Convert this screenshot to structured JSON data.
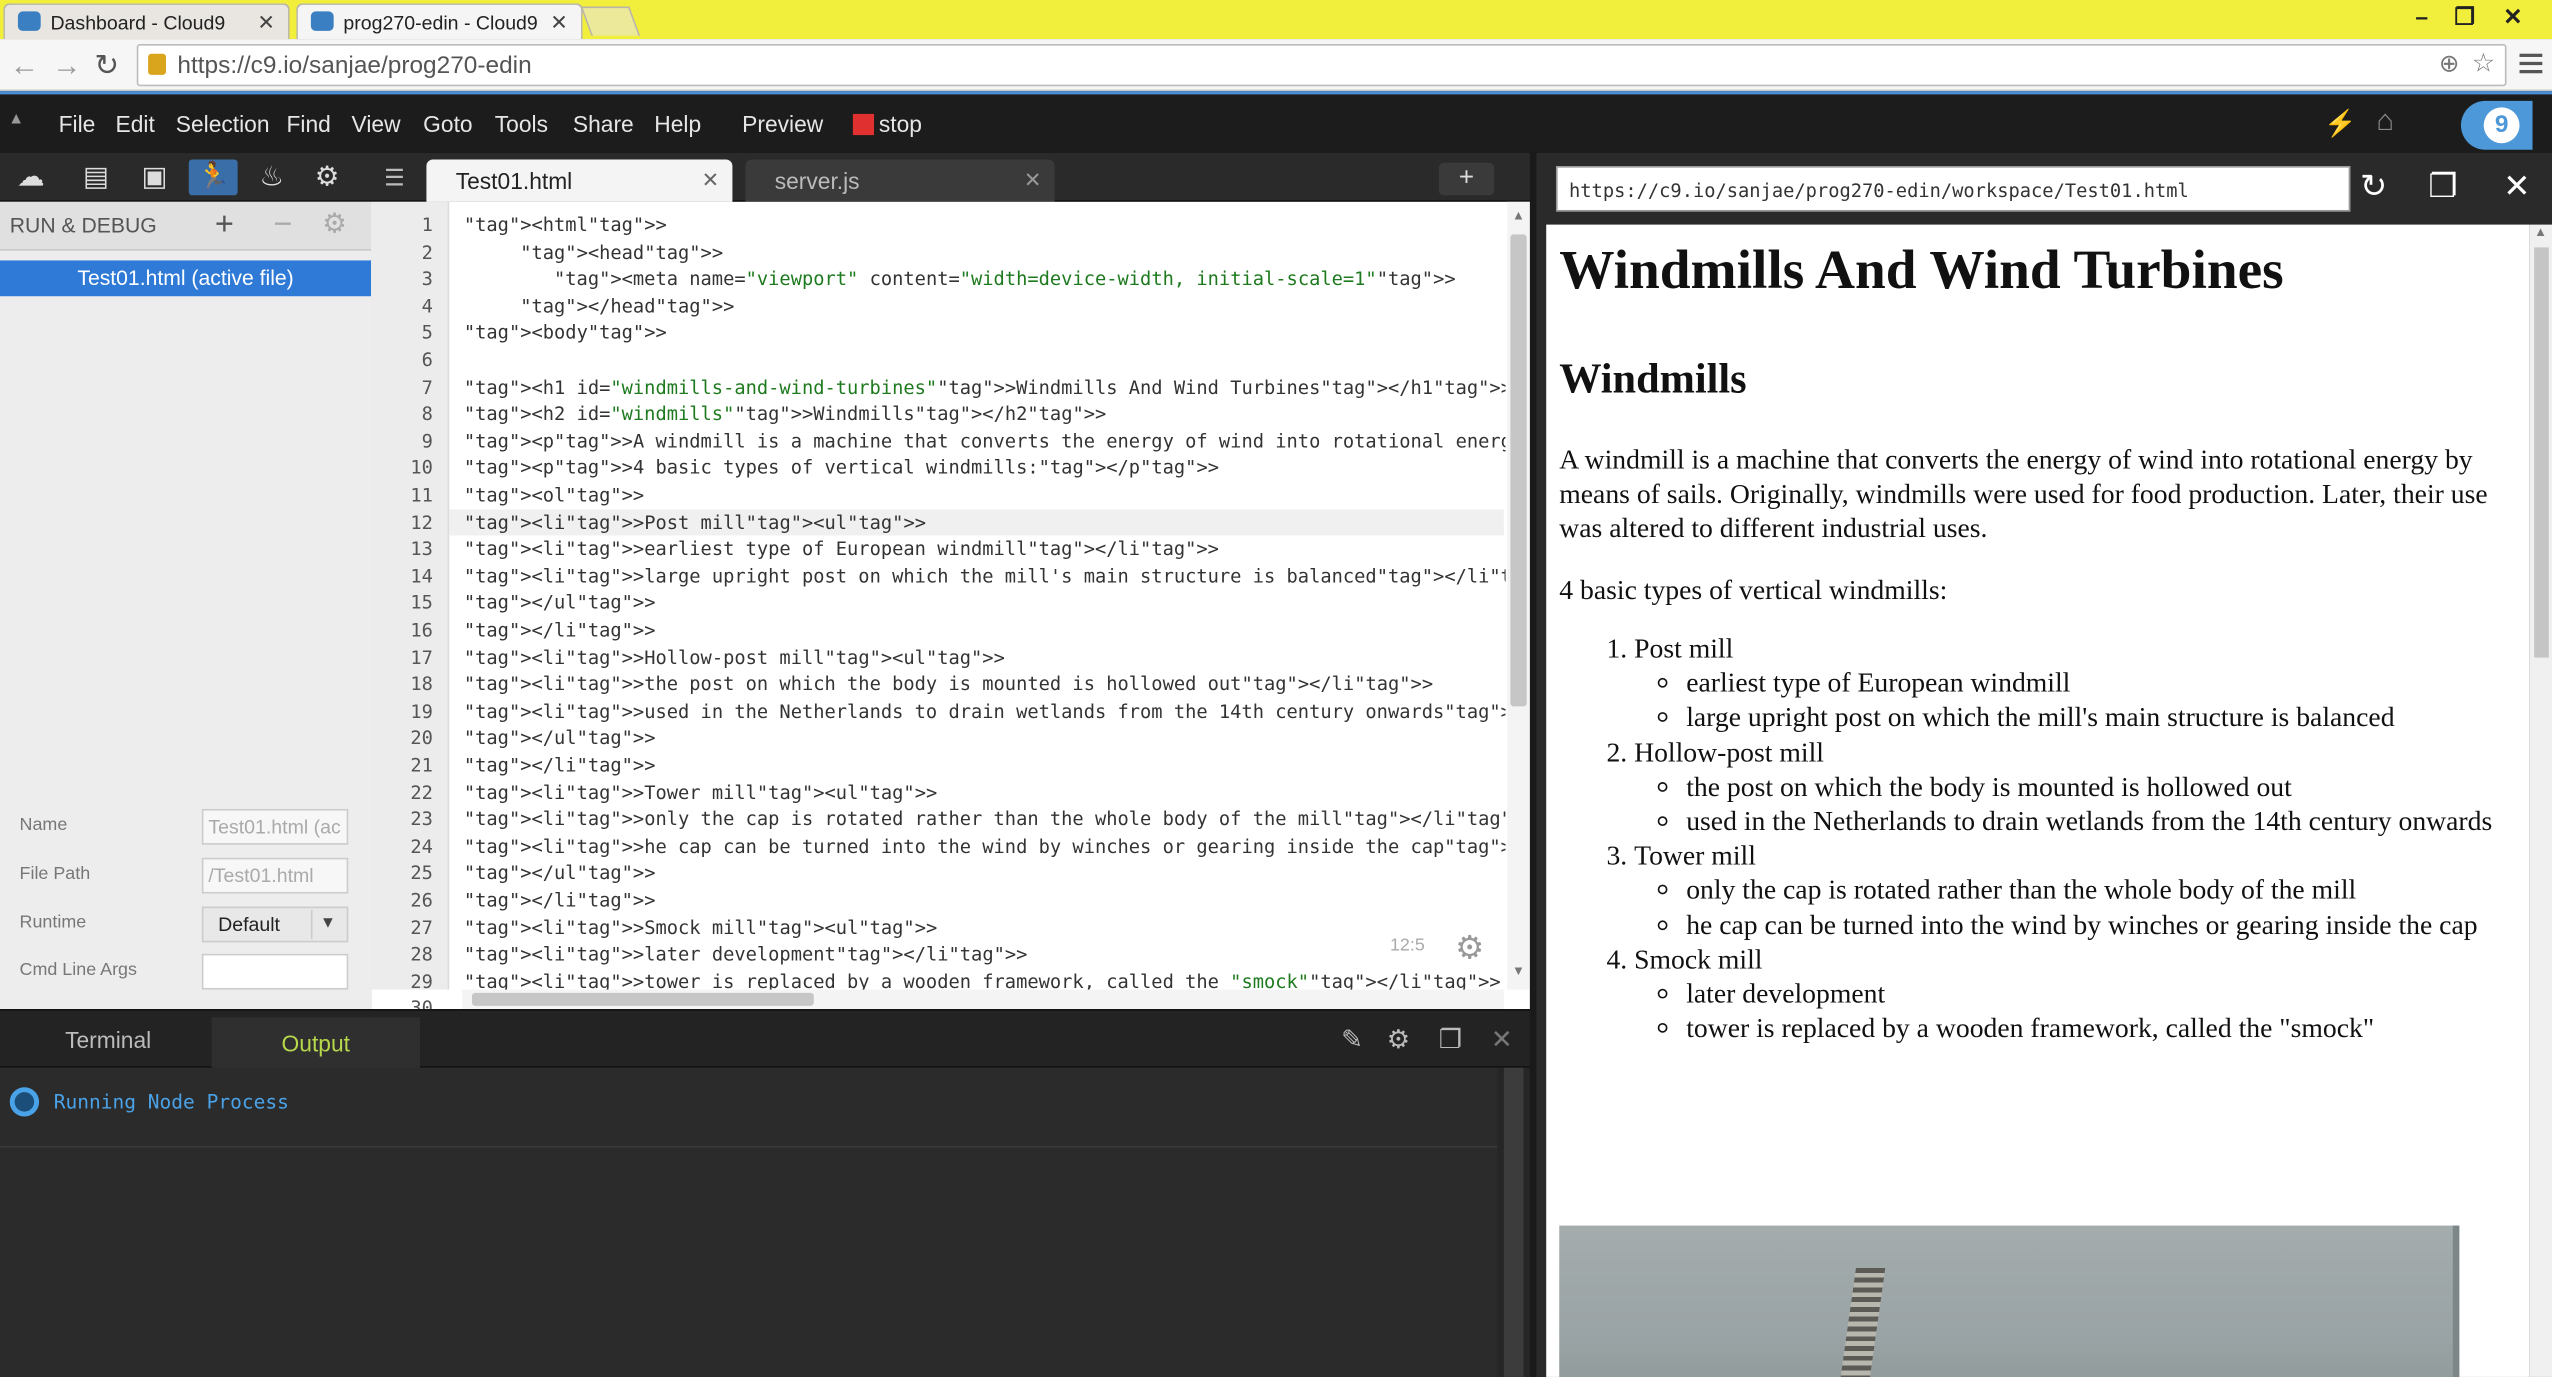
{
  "browser": {
    "tabs": [
      {
        "label": "Dashboard - Cloud9",
        "active": false
      },
      {
        "label": "prog270-edin - Cloud9",
        "active": true
      }
    ],
    "url": "https://c9.io/sanjae/prog270-edin",
    "window_controls": [
      "–",
      "❐",
      "✕"
    ]
  },
  "menu": {
    "items": [
      "File",
      "Edit",
      "Selection",
      "Find",
      "View",
      "Goto",
      "Tools",
      "Share",
      "Help"
    ],
    "preview": "Preview",
    "stop": "stop"
  },
  "run_panel": {
    "title": "RUN & DEBUG",
    "active_file": "Test01.html (active file)",
    "fields": [
      {
        "label": "Name",
        "value": "Test01.html (ac"
      },
      {
        "label": "File Path",
        "value": "/Test01.html"
      },
      {
        "label": "Runtime",
        "value": "Default"
      },
      {
        "label": "Cmd Line Args",
        "value": ""
      }
    ]
  },
  "editor": {
    "tabs": [
      {
        "label": "Test01.html",
        "active": true
      },
      {
        "label": "server.js",
        "active": false
      }
    ],
    "new_tab": "+",
    "line_numbers": [
      "1",
      "2",
      "3",
      "4",
      "5",
      "6",
      "7",
      "8",
      "9",
      "10",
      "11",
      "12",
      "13",
      "14",
      "15",
      "16",
      "17",
      "18",
      "19",
      "20",
      "21",
      "22",
      "23",
      "24",
      "25",
      "26",
      "27",
      "28",
      "29",
      "30"
    ],
    "lines": [
      "<html>",
      "     <head>",
      "        <meta name=\"viewport\" content=\"width=device-width, initial-scale=1\">",
      "     </head>",
      "<body>",
      "",
      "<h1 id=\"windmills-and-wind-turbines\">Windmills And Wind Turbines</h1>",
      "<h2 id=\"windmills\">Windmills</h2>",
      "<p>A windmill is a machine that converts the energy of wind into rotational energy by r",
      "<p>4 basic types of vertical windmills:</p>",
      "<ol>",
      "<li>Post mill<ul>",
      "<li>earliest type of European windmill</li>",
      "<li>large upright post on which the mill's main structure is balanced</li>",
      "</ul>",
      "</li>",
      "<li>Hollow-post mill<ul>",
      "<li>the post on which the body is mounted is hollowed out</li>",
      "<li>used in the Netherlands to drain wetlands from the 14th century onwards</li>",
      "</ul>",
      "</li>",
      "<li>Tower mill<ul>",
      "<li>only the cap is rotated rather than the whole body of the mill</li>",
      "<li>he cap can be turned into the wind by winches or gearing inside the cap</li>",
      "</ul>",
      "</li>",
      "<li>Smock mill<ul>",
      "<li>later development</li>",
      "<li>tower is replaced by a wooden framework, called the \"smock\"</li>",
      ""
    ],
    "cursor_position": "12:5"
  },
  "bottom_panel": {
    "tabs": [
      "Terminal",
      "Output"
    ],
    "active_tab": "Output",
    "status": "Running Node Process"
  },
  "preview": {
    "url": "https://c9.io/sanjae/prog270-edin/workspace/Test01.html",
    "h1": "Windmills And Wind Turbines",
    "h2": "Windmills",
    "p1": "A windmill is a machine that converts the energy of wind into rotational energy by means of sails. Originally, windmills were used for food production. Later, their use was altered to different industrial uses.",
    "p2": "4 basic types of vertical windmills:",
    "list": [
      {
        "title": "Post mill",
        "items": [
          "earliest type of European windmill",
          "large upright post on which the mill's main structure is balanced"
        ]
      },
      {
        "title": "Hollow-post mill",
        "items": [
          "the post on which the body is mounted is hollowed out",
          "used in the Netherlands to drain wetlands from the 14th century onwards"
        ]
      },
      {
        "title": "Tower mill",
        "items": [
          "only the cap is rotated rather than the whole body of the mill",
          "he cap can be turned into the wind by winches or gearing inside the cap"
        ]
      },
      {
        "title": "Smock mill",
        "items": [
          "later development",
          "tower is replaced by a wooden framework, called the \"smock\""
        ]
      }
    ]
  },
  "colors": {
    "accent": "#2e7ad6",
    "titlebar": "#f1ee3c",
    "output_tab": "#b6d84a",
    "run_status": "#4aa3e8"
  }
}
